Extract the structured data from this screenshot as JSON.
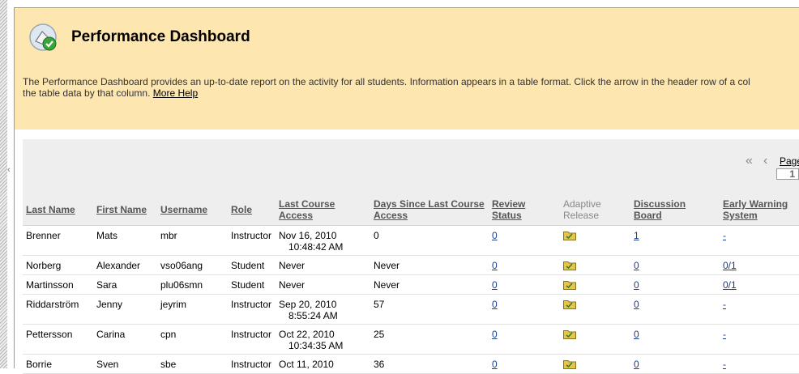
{
  "header": {
    "title": "Performance Dashboard",
    "description": "The Performance Dashboard provides an up-to-date report on the activity for all students. Information appears in a table format. Click the arrow in the header row of a col",
    "description_line2": "the table data by that column.",
    "more_help": "More Help"
  },
  "pager": {
    "first": "«",
    "prev": "‹",
    "label": "Page",
    "current": "1"
  },
  "table": {
    "columns": [
      {
        "label": "Last Name",
        "sortable": true
      },
      {
        "label": "First Name",
        "sortable": true
      },
      {
        "label": "Username",
        "sortable": true
      },
      {
        "label": "Role",
        "sortable": true
      },
      {
        "label": "Last Course Access",
        "sortable": true
      },
      {
        "label": "Days Since Last Course Access",
        "sortable": true
      },
      {
        "label": "Review Status",
        "sortable": true
      },
      {
        "label": "Adaptive Release",
        "sortable": false
      },
      {
        "label": "Discussion Board",
        "sortable": true
      },
      {
        "label": "Early Warning System",
        "sortable": true
      }
    ],
    "rows": [
      {
        "last": "Brenner",
        "first": "Mats",
        "user": "mbr",
        "role": "Instructor",
        "access": "Nov 16, 2010",
        "access_time": "10:48:42 AM",
        "days": "0",
        "review": "0",
        "board": "1",
        "ews": "-"
      },
      {
        "last": "Norberg",
        "first": "Alexander",
        "user": "vso06ang",
        "role": "Student",
        "access": "Never",
        "access_time": "",
        "days": "Never",
        "review": "0",
        "board": "0",
        "ews": "0/1"
      },
      {
        "last": "Martinsson",
        "first": "Sara",
        "user": "plu06smn",
        "role": "Student",
        "access": "Never",
        "access_time": "",
        "days": "Never",
        "review": "0",
        "board": "0",
        "ews": "0/1"
      },
      {
        "last": "Riddarström",
        "first": "Jenny",
        "user": "jeyrim",
        "role": "Instructor",
        "access": "Sep 20, 2010",
        "access_time": "8:55:24 AM",
        "days": "57",
        "review": "0",
        "board": "0",
        "ews": "-"
      },
      {
        "last": "Pettersson",
        "first": "Carina",
        "user": "cpn",
        "role": "Instructor",
        "access": "Oct 22, 2010",
        "access_time": "10:34:35 AM",
        "days": "25",
        "review": "0",
        "board": "0",
        "ews": "-"
      },
      {
        "last": "Borrie",
        "first": "Sven",
        "user": "sbe",
        "role": "Instructor",
        "access": "Oct 11, 2010",
        "access_time": "",
        "days": "36",
        "review": "0",
        "board": "0",
        "ews": "-"
      }
    ]
  },
  "icons": {
    "title_icon": "dashboard-check-icon",
    "adaptive_release_icon": "folder-icon",
    "collapse_icon": "chevron-left-icon"
  }
}
